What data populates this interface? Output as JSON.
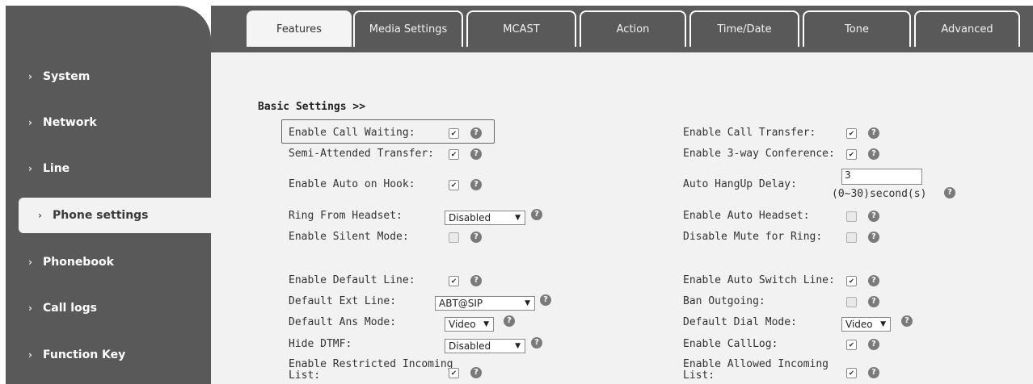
{
  "sidebar": {
    "items": [
      {
        "label": "System"
      },
      {
        "label": "Network"
      },
      {
        "label": "Line"
      },
      {
        "label": "Phone settings"
      },
      {
        "label": "Phonebook"
      },
      {
        "label": "Call logs"
      },
      {
        "label": "Function Key"
      }
    ]
  },
  "tabs": [
    {
      "label": "Features"
    },
    {
      "label": "Media Settings"
    },
    {
      "label": "MCAST"
    },
    {
      "label": "Action"
    },
    {
      "label": "Time/Date"
    },
    {
      "label": "Tone"
    },
    {
      "label": "Advanced"
    }
  ],
  "section_title": "Basic Settings >>",
  "help_glyph": "?",
  "check_glyph": "✔",
  "left": {
    "call_waiting": {
      "label": "Enable Call Waiting:",
      "checked": true
    },
    "semi_attended": {
      "label": "Semi-Attended Transfer:",
      "checked": true
    },
    "auto_on_hook": {
      "label": "Enable Auto on Hook:",
      "checked": true
    },
    "ring_from_headset": {
      "label": "Ring From Headset:",
      "value": "Disabled"
    },
    "silent_mode": {
      "label": "Enable Silent Mode:",
      "checked": false
    },
    "default_line": {
      "label": "Enable Default Line:",
      "checked": true
    },
    "default_ext_line": {
      "label": "Default Ext Line:",
      "value": "ABT@SIP"
    },
    "default_ans_mode": {
      "label": "Default Ans Mode:",
      "value": "Video"
    },
    "hide_dtmf": {
      "label": "Hide DTMF:",
      "value": "Disabled"
    },
    "restricted_incoming": {
      "label_1": "Enable Restricted Incoming",
      "label_2": "List:",
      "checked": true
    }
  },
  "right": {
    "call_transfer": {
      "label": "Enable Call Transfer:",
      "checked": true
    },
    "three_way": {
      "label": "Enable 3-way Conference:",
      "checked": true
    },
    "auto_hangup_delay": {
      "label": "Auto HangUp Delay:",
      "value": "3",
      "hint": "(0~30)second(s)"
    },
    "auto_headset": {
      "label": "Enable Auto Headset:",
      "checked": false
    },
    "disable_mute_ring": {
      "label": "Disable Mute for Ring:",
      "checked": false
    },
    "auto_switch_line": {
      "label": "Enable Auto Switch Line:",
      "checked": true
    },
    "ban_outgoing": {
      "label": "Ban Outgoing:",
      "checked": false
    },
    "default_dial_mode": {
      "label": "Default Dial Mode:",
      "value": "Video"
    },
    "enable_calllog": {
      "label": "Enable CallLog:",
      "checked": true
    },
    "allowed_incoming": {
      "label_1": "Enable Allowed Incoming",
      "label_2": "List:",
      "checked": true
    }
  }
}
